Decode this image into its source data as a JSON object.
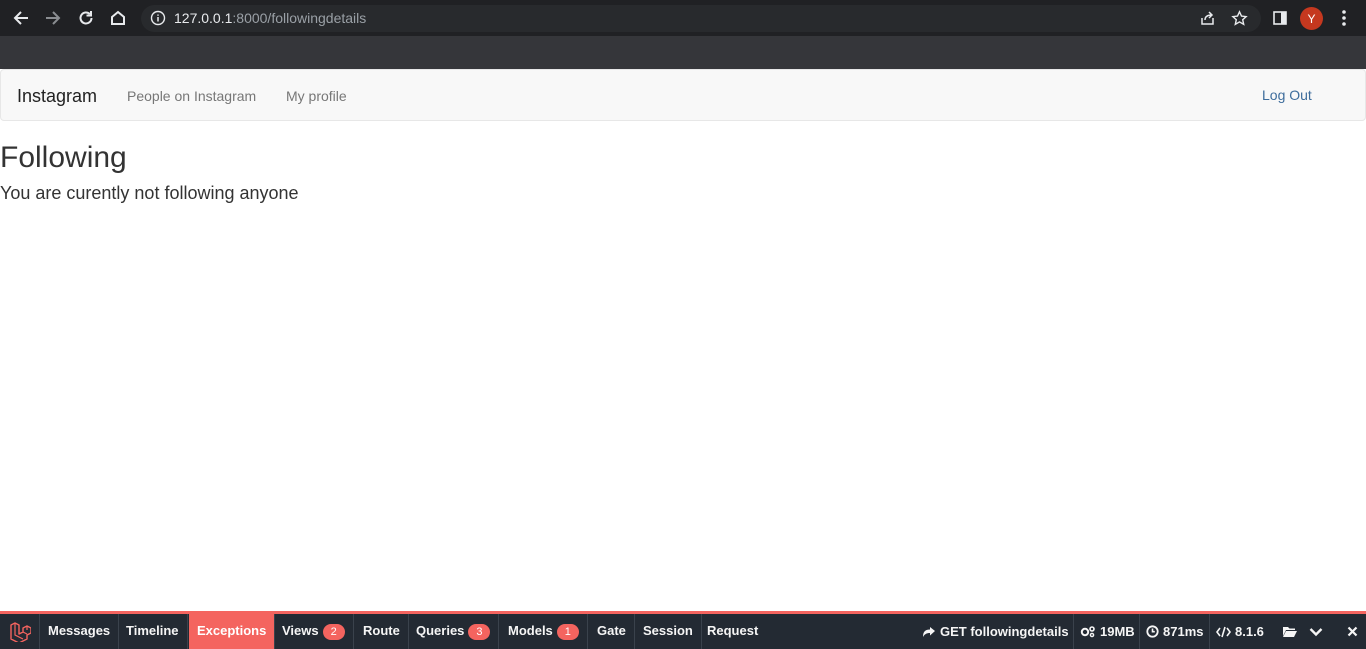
{
  "browser": {
    "url_host": "127.0.0.1",
    "url_path": ":8000/followingdetails",
    "avatar_letter": "Y"
  },
  "navbar": {
    "brand": "Instagram",
    "links": [
      "People on Instagram",
      "My profile"
    ],
    "logout": "Log Out"
  },
  "page": {
    "title": "Following",
    "message": "You are curently not following anyone"
  },
  "debugbar": {
    "tabs": [
      {
        "label": "Messages"
      },
      {
        "label": "Timeline"
      },
      {
        "label": "Exceptions",
        "active": true
      },
      {
        "label": "Views",
        "badge": "2"
      },
      {
        "label": "Route"
      },
      {
        "label": "Queries",
        "badge": "3"
      },
      {
        "label": "Models",
        "badge": "1"
      },
      {
        "label": "Gate"
      },
      {
        "label": "Session"
      },
      {
        "label": "Request"
      }
    ],
    "request": "GET followingdetails",
    "memory": "19MB",
    "time": "871ms",
    "php_version": "8.1.6",
    "accent_color": "#f4645f"
  },
  "icons": [
    "back-arrow-icon",
    "forward-arrow-icon",
    "reload-icon",
    "home-icon",
    "info-icon",
    "share-icon",
    "star-icon",
    "side-panel-icon",
    "kebab-menu-icon",
    "laravel-logo-icon",
    "share-arrow-icon",
    "cogs-icon",
    "clock-icon",
    "code-icon",
    "folder-open-icon",
    "chevron-down-icon",
    "close-icon"
  ]
}
